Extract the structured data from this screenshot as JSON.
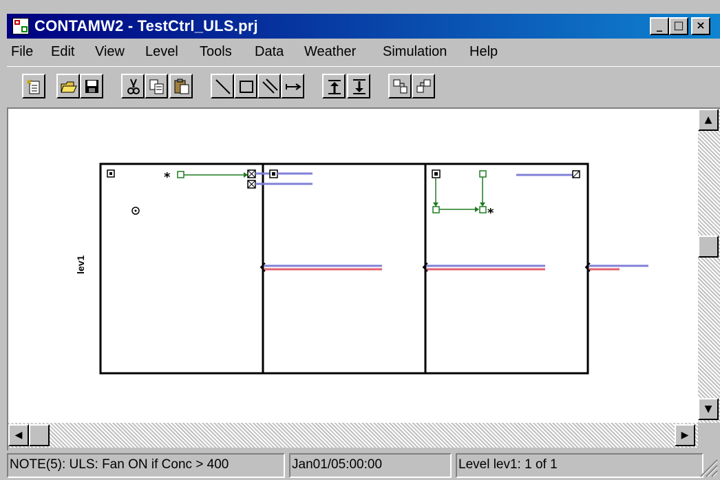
{
  "window": {
    "title": "CONTAMW2 - TestCtrl_ULS.prj",
    "controls": {
      "minimize": "_",
      "maximize": "□",
      "close": "×"
    }
  },
  "menu": {
    "items": [
      "File",
      "Edit",
      "View",
      "Level",
      "Tools",
      "Data",
      "Weather",
      "Simulation",
      "Help"
    ]
  },
  "toolbar": {
    "buttons": [
      "new-icon",
      "open-icon",
      "save-icon",
      "cut-icon",
      "copy-icon",
      "paste-icon",
      "draw-line-icon",
      "draw-rectangle-icon",
      "draw-wall-icon",
      "draw-duct-icon",
      "level-up-icon",
      "level-down-icon",
      "level-icon-1",
      "level-icon-2"
    ]
  },
  "canvas": {
    "level_marker": "lev1"
  },
  "status": {
    "note": "NOTE(5): ULS: Fan ON if Conc > 400",
    "time": "Jan01/05:00:00",
    "level": "Level lev1: 1 of 1"
  },
  "colors": {
    "title_start": "#000080",
    "title_end": "#1084d0",
    "control_wire": "#1f7a1f",
    "duct_blue": "#8080d8",
    "duct_red": "#e06070"
  }
}
